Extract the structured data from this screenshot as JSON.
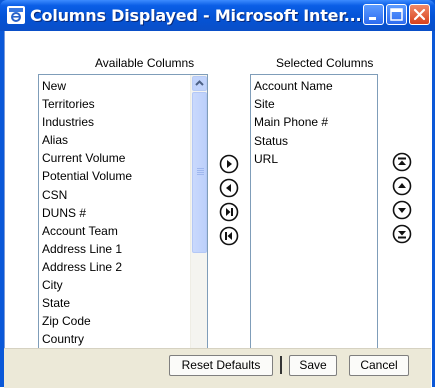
{
  "window": {
    "title": "Columns Displayed - Microsoft Inter...",
    "controls": {
      "minimize": "minimize",
      "maximize": "maximize",
      "close": "close"
    }
  },
  "available": {
    "label": "Available Columns",
    "items": [
      "New",
      "Territories",
      "Industries",
      "Alias",
      "Current Volume",
      "Potential Volume",
      "CSN",
      "DUNS #",
      "Account Team",
      "Address Line 1",
      "Address Line 2",
      "City",
      "State",
      "Zip Code",
      "Country"
    ]
  },
  "selected": {
    "label": "Selected Columns",
    "items": [
      "Account Name",
      "Site",
      "Main Phone #",
      "Status",
      "URL"
    ]
  },
  "transfer_buttons": [
    "move-right",
    "move-left",
    "move-all-right",
    "move-all-left"
  ],
  "order_buttons": [
    "move-to-top",
    "move-up",
    "move-down",
    "move-to-bottom"
  ],
  "footer": {
    "reset_label": "Reset Defaults",
    "save_label": "Save",
    "cancel_label": "Cancel"
  },
  "colors": {
    "title_bar": "#0453d6",
    "window_frame": "#0a58d8",
    "list_border": "#7f9db9",
    "scrollbar": "#c1d3fb",
    "footer_bg": "#ece9d8"
  }
}
